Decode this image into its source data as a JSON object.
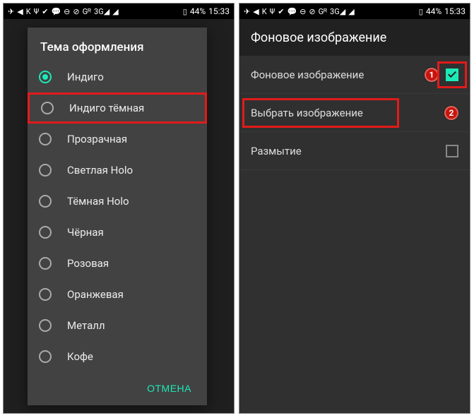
{
  "statusbar": {
    "icons_left": [
      "paper-plane-icon",
      "k-icon",
      "usb-icon",
      "check-icon",
      "chat-icon",
      "minus-circle-icon",
      "wifi-icon",
      "g-roaming-icon",
      "3g-signal-icon",
      "signal-icon"
    ],
    "battery_text": "44%",
    "time": "15:33"
  },
  "screen1": {
    "dialog_title": "Тема оформления",
    "options": [
      {
        "label": "Индиго",
        "selected": true,
        "highlighted": false
      },
      {
        "label": "Индиго тёмная",
        "selected": false,
        "highlighted": true
      },
      {
        "label": "Прозрачная",
        "selected": false,
        "highlighted": false
      },
      {
        "label": "Светлая Holo",
        "selected": false,
        "highlighted": false
      },
      {
        "label": "Тёмная Holo",
        "selected": false,
        "highlighted": false
      },
      {
        "label": "Чёрная",
        "selected": false,
        "highlighted": false
      },
      {
        "label": "Розовая",
        "selected": false,
        "highlighted": false
      },
      {
        "label": "Оранжевая",
        "selected": false,
        "highlighted": false
      },
      {
        "label": "Металл",
        "selected": false,
        "highlighted": false
      },
      {
        "label": "Кофе",
        "selected": false,
        "highlighted": false
      }
    ],
    "cancel_label": "ОТМЕНА"
  },
  "screen2": {
    "title": "Фоновое изображение",
    "rows": [
      {
        "label": "Фоновое изображение",
        "checkbox": true,
        "checked": true,
        "callout": "1",
        "cb_highlight": true
      },
      {
        "label": "Выбрать изображение",
        "checkbox": false,
        "callout": "2",
        "row_highlight": true
      },
      {
        "label": "Размытие",
        "checkbox": true,
        "checked": false
      }
    ]
  },
  "colors": {
    "accent": "#1de9b6",
    "highlight": "#e21b1b"
  }
}
